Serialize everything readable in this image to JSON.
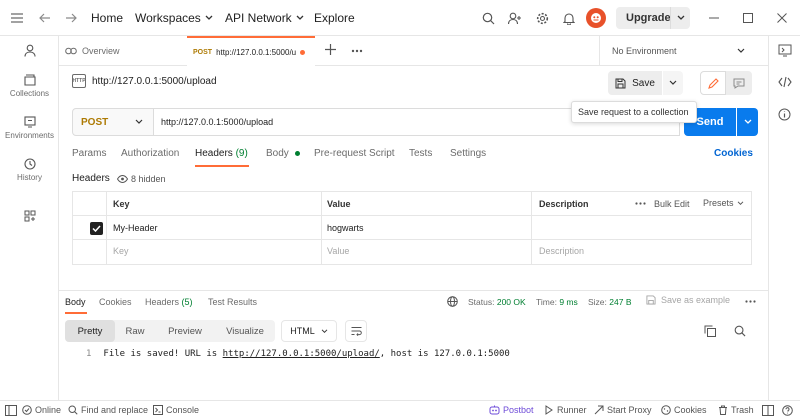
{
  "topbar": {
    "nav": {
      "home": "Home",
      "workspaces": "Workspaces",
      "api_network": "API Network",
      "explore": "Explore"
    },
    "upgrade_label": "Upgrade"
  },
  "rail": {
    "items": [
      {
        "label": ""
      },
      {
        "label": "Collections"
      },
      {
        "label": "Environments"
      },
      {
        "label": "History"
      }
    ]
  },
  "tabs": {
    "overview_label": "Overview",
    "active": {
      "method": "POST",
      "label": "http://127.0.0.1:5000/u"
    },
    "environment": "No Environment"
  },
  "request": {
    "title": "http://127.0.0.1:5000/upload",
    "http_badge": "HTTP",
    "save_label": "Save",
    "tooltip": "Save request to a collection",
    "method": "POST",
    "url": "http://127.0.0.1:5000/upload",
    "send_label": "Send",
    "subtabs": {
      "params": "Params",
      "authorization": "Authorization",
      "headers": "Headers",
      "headers_count": "(9)",
      "body": "Body",
      "prerequest": "Pre-request Script",
      "tests": "Tests",
      "settings": "Settings"
    },
    "cookies_label": "Cookies",
    "headers_label": "Headers",
    "hidden_label": "8 hidden"
  },
  "headers_table": {
    "columns": {
      "key": "Key",
      "value": "Value",
      "description": "Description"
    },
    "bulk_edit": "Bulk Edit",
    "presets": "Presets",
    "rows": [
      {
        "key": "My-Header",
        "value": "hogwarts",
        "description": ""
      }
    ],
    "placeholder": {
      "key": "Key",
      "value": "Value",
      "description": "Description"
    }
  },
  "response": {
    "tabs": {
      "body": "Body",
      "cookies": "Cookies",
      "headers": "Headers",
      "headers_count": "(5)",
      "test_results": "Test Results"
    },
    "status_label": "Status:",
    "status_value": "200 OK",
    "time_label": "Time:",
    "time_value": "9 ms",
    "size_label": "Size:",
    "size_value": "247 B",
    "save_example": "Save as example",
    "formats": {
      "pretty": "Pretty",
      "raw": "Raw",
      "preview": "Preview",
      "visualize": "Visualize"
    },
    "language": "HTML",
    "line_number": "1",
    "body_prefix": "File is saved! URL is ",
    "body_link": "http://127.0.0.1:5000/upload/",
    "body_suffix": ", host is 127.0.0.1:5000"
  },
  "statusbar": {
    "online": "Online",
    "find_replace": "Find and replace",
    "console": "Console",
    "postbot": "Postbot",
    "runner": "Runner",
    "start_proxy": "Start Proxy",
    "cookies": "Cookies",
    "trash": "Trash"
  },
  "colors": {
    "accent": "#ff6c37",
    "send": "#097bed",
    "method_post": "#ad7a03",
    "status_ok": "#007f31",
    "link": "#0265d2",
    "postbot": "#6e4bd8"
  }
}
